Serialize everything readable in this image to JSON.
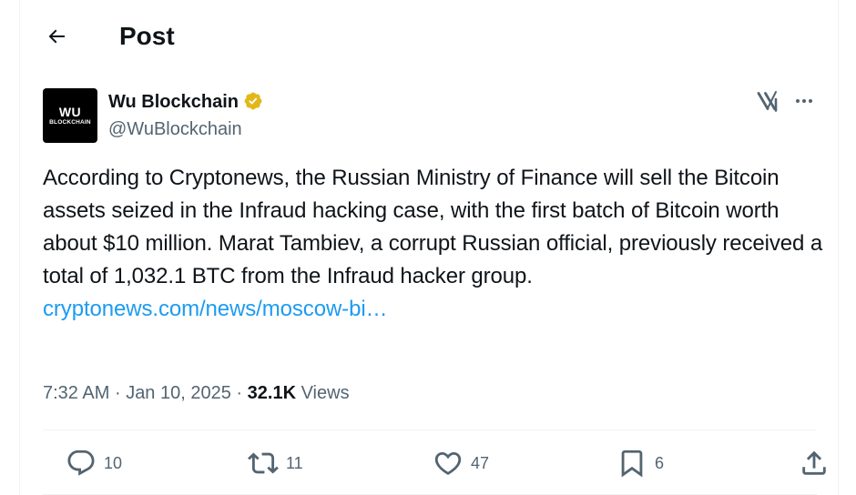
{
  "header": {
    "title": "Post",
    "back_icon": "arrow-left-icon"
  },
  "author": {
    "name": "Wu Blockchain",
    "handle": "@WuBlockchain",
    "verified_badge": "verified-gold-badge-icon",
    "verified_color": "#e2b719",
    "avatar": {
      "main": "WU",
      "sub": "BLOCKCHAIN"
    }
  },
  "tweet": {
    "text": "According to Cryptonews, the Russian Ministry of Finance will sell the Bitcoin assets seized in the Infraud hacking case, with the first batch of Bitcoin worth about $10 million. Marat Tambiev, a corrupt Russian official, previously received a total of 1,032.1 BTC from the Infraud hacker group.",
    "link": "cryptonews.com/news/moscow-bi…",
    "link_color": "#1d9bf0"
  },
  "meta": {
    "time": "7:32 AM",
    "date": "Jan 10, 2025",
    "separator": "·",
    "views_count": "32.1K",
    "views_label": "Views"
  },
  "actions": {
    "reply": {
      "icon": "reply-icon",
      "count": "10"
    },
    "repost": {
      "icon": "repost-icon",
      "count": "11"
    },
    "like": {
      "icon": "heart-icon",
      "count": "47"
    },
    "bookmark": {
      "icon": "bookmark-icon",
      "count": "6"
    },
    "share": {
      "icon": "share-icon"
    }
  },
  "toolbar": {
    "grok_icon": "grok-icon",
    "more_icon": "more-icon"
  },
  "colors": {
    "text": "#0f1419",
    "secondary": "#536471",
    "border": "#eff3f4",
    "accent": "#1d9bf0"
  }
}
